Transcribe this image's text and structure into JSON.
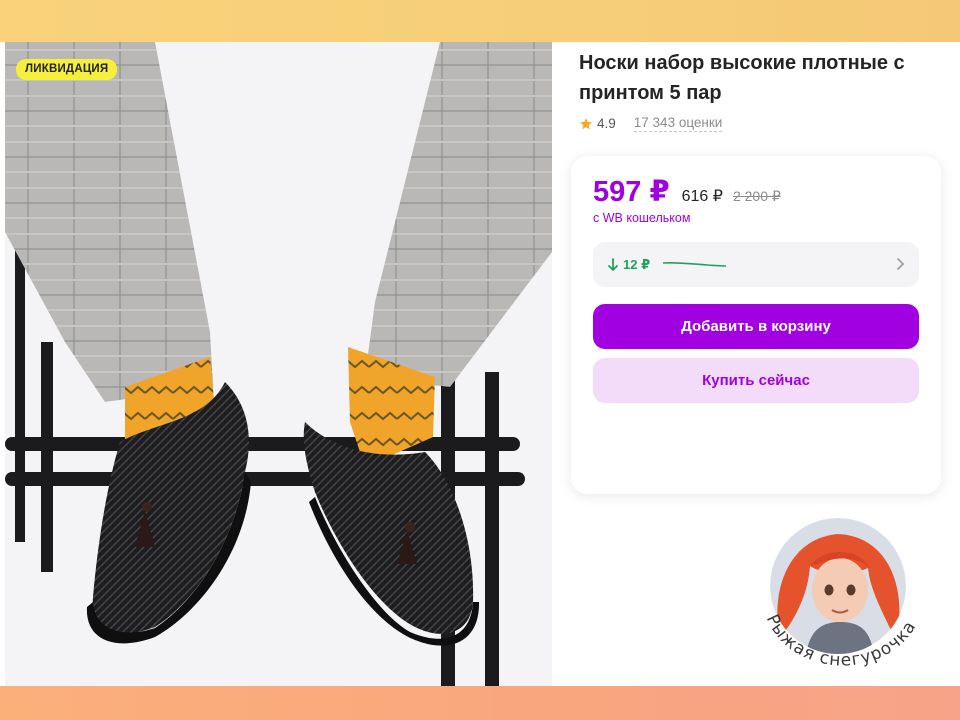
{
  "product": {
    "badge": "ЛИКВИДАЦИЯ",
    "title": "Носки набор высокие плотные с принтом 5 пар",
    "rating": "4.9",
    "reviews": "17 343 оценки"
  },
  "pricing": {
    "price": "597 ₽",
    "price_regular": "616 ₽",
    "price_old": "2 200 ₽",
    "wallet_note": "с WB кошельком",
    "trend_delta": "12 ₽"
  },
  "actions": {
    "add_to_cart": "Добавить в корзину",
    "buy_now": "Купить сейчас"
  },
  "watermark": {
    "text": "Рыжая снегурочка"
  },
  "colors": {
    "accent": "#a100e0",
    "accent_light": "#f3dcfa",
    "trend_green": "#1ea35e",
    "badge_yellow": "#f6ef3c",
    "top_band": "#f7ce78",
    "bottom_band": "#f9a97f"
  },
  "icons": {
    "rating": "star-icon",
    "trend": "arrow-down-icon",
    "trend_more": "chevron-right-icon"
  }
}
